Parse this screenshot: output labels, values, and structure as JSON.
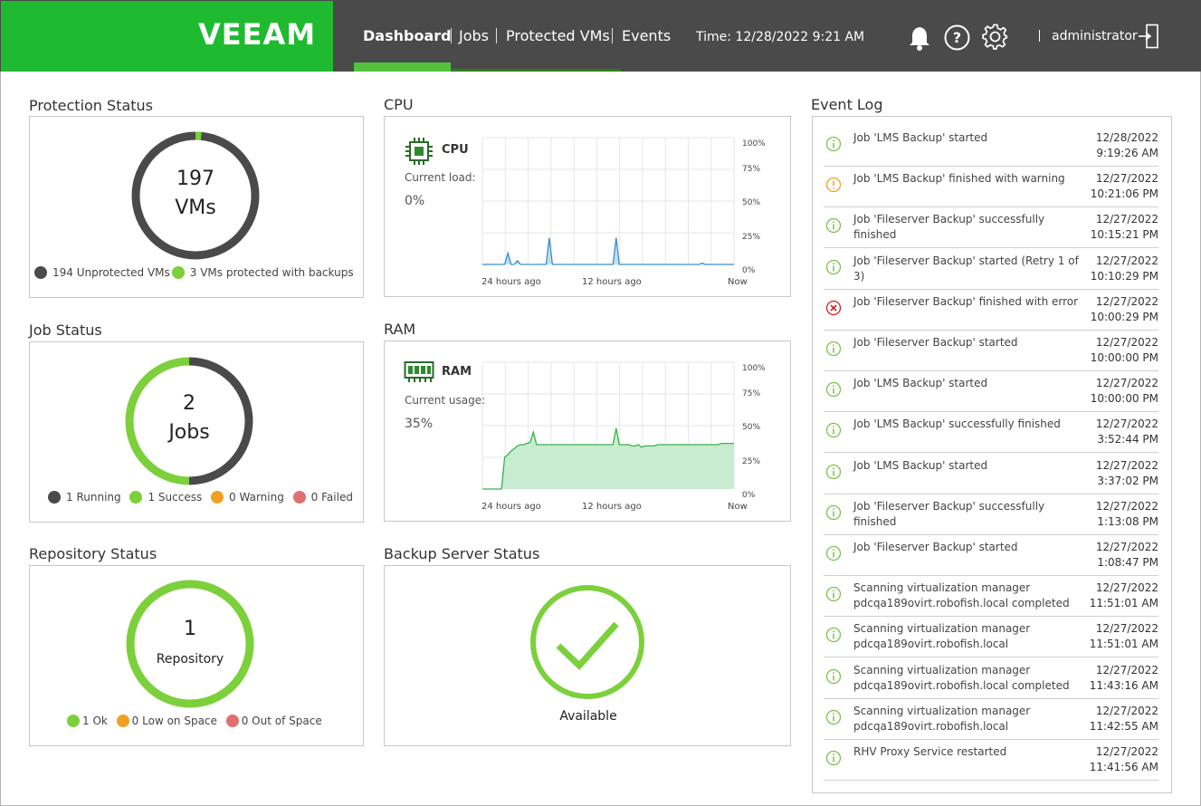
{
  "header": {
    "logo": "VEEAM",
    "nav": [
      "Dashboard",
      "Jobs",
      "Protected VMs",
      "Events"
    ],
    "time": "Time: 12/28/2022 9:21 AM",
    "user": "administrator",
    "icons": [
      "bell-icon",
      "help-icon",
      "settings-icon",
      "logout-icon"
    ]
  },
  "protection": {
    "title": "Protection Status",
    "count": "197",
    "unit": "VMs",
    "legend": [
      "194 Unprotected VMs",
      "3 VMs protected with backups"
    ],
    "protected_fraction": 0.0152,
    "colors": {
      "unprotected": "#4a4a4a",
      "protected": "#7cd03b"
    }
  },
  "cpu": {
    "section_title": "CPU",
    "name": "CPU",
    "load_label": "Current load:",
    "load_value": "0%",
    "y_ticks": [
      "100%",
      "75%",
      "50%",
      "25%",
      "0%"
    ],
    "x_ticks": [
      "24 hours ago",
      "12 hours ago",
      "Now"
    ],
    "values": [
      0,
      0,
      0,
      0,
      0,
      0,
      0,
      0,
      9,
      0,
      0,
      3,
      0,
      0,
      0,
      0,
      0,
      0,
      0,
      0,
      0,
      21,
      0,
      0,
      0,
      0,
      0,
      0,
      0,
      0,
      0,
      0,
      0,
      0,
      0,
      0,
      0,
      0,
      0,
      0,
      0,
      0,
      21,
      0,
      0,
      0,
      0,
      0,
      0,
      0,
      0,
      0,
      0,
      0,
      0,
      0,
      0,
      0,
      0,
      0,
      0,
      0,
      0,
      0,
      0,
      0,
      0,
      0,
      0,
      1,
      0,
      0,
      0,
      0,
      0,
      0,
      0,
      0,
      0,
      0
    ],
    "color": "#3a8fc9"
  },
  "ram": {
    "section_title": "RAM",
    "name": "RAM",
    "usage_label": "Current usage:",
    "usage_value": "35%",
    "y_ticks": [
      "100%",
      "75%",
      "50%",
      "25%",
      "0%"
    ],
    "x_ticks": [
      "24 hours ago",
      "12 hours ago",
      "Now"
    ],
    "values": [
      0,
      0,
      0,
      0,
      0,
      0,
      0,
      25,
      27,
      30,
      32,
      34,
      35,
      35,
      36,
      37,
      45,
      35,
      35,
      35,
      35,
      35,
      35,
      35,
      35,
      35,
      35,
      35,
      35,
      35,
      35,
      35,
      35,
      35,
      35,
      35,
      35,
      35,
      35,
      35,
      35,
      35,
      48,
      35,
      35,
      35,
      35,
      34,
      34,
      35,
      33,
      34,
      34,
      34,
      34,
      35,
      35,
      35,
      35,
      35,
      35,
      35,
      35,
      35,
      35,
      35,
      35,
      35,
      35,
      35,
      35,
      35,
      35,
      35,
      35,
      36,
      36,
      36,
      36,
      36
    ],
    "color": "#37b24d"
  },
  "jobs": {
    "title": "Job Status",
    "count": "2",
    "unit": "Jobs",
    "legend": [
      "1 Running",
      "1 Success",
      "0 Warning",
      "0 Failed"
    ],
    "colors": [
      "#4a4a4a",
      "#7cd03b",
      "#f0a020",
      "#e07070"
    ]
  },
  "repository": {
    "title": "Repository Status",
    "count": "1",
    "unit": "Repository",
    "legend": [
      "1 Ok",
      "0 Low on Space",
      "0 Out of Space"
    ],
    "colors": [
      "#7cd03b",
      "#f0a020",
      "#e07070"
    ]
  },
  "server": {
    "title": "Backup Server Status",
    "status": "Available"
  },
  "event_log": {
    "title": "Event Log",
    "events": [
      {
        "type": "info",
        "text": "Job 'LMS Backup' started",
        "date": "12/28/2022",
        "time": "9:19:26 AM"
      },
      {
        "type": "warning",
        "text": "Job 'LMS Backup' finished with warning",
        "date": "12/27/2022",
        "time": "10:21:06 PM"
      },
      {
        "type": "info",
        "text": "Job 'Fileserver Backup' successfully finished",
        "date": "12/27/2022",
        "time": "10:15:21 PM"
      },
      {
        "type": "info",
        "text": "Job 'Fileserver Backup' started (Retry 1 of 3)",
        "date": "12/27/2022",
        "time": "10:10:29 PM"
      },
      {
        "type": "error",
        "text": "Job 'Fileserver Backup' finished with error",
        "date": "12/27/2022",
        "time": "10:00:29 PM"
      },
      {
        "type": "info",
        "text": "Job 'Fileserver Backup' started",
        "date": "12/27/2022",
        "time": "10:00:00 PM"
      },
      {
        "type": "info",
        "text": "Job 'LMS Backup' started",
        "date": "12/27/2022",
        "time": "10:00:00 PM"
      },
      {
        "type": "info",
        "text": "Job 'LMS Backup' successfully finished",
        "date": "12/27/2022",
        "time": "3:52:44 PM"
      },
      {
        "type": "info",
        "text": "Job 'LMS Backup' started",
        "date": "12/27/2022",
        "time": "3:37:02 PM"
      },
      {
        "type": "info",
        "text": "Job 'Fileserver Backup' successfully finished",
        "date": "12/27/2022",
        "time": "1:13:08 PM"
      },
      {
        "type": "info",
        "text": "Job 'Fileserver Backup' started",
        "date": "12/27/2022",
        "time": "1:08:47 PM"
      },
      {
        "type": "info",
        "text": "Scanning virtualization manager pdcqa189ovirt.robofish.local completed",
        "date": "12/27/2022",
        "time": "11:51:01 AM"
      },
      {
        "type": "info",
        "text": "Scanning virtualization manager pdcqa189ovirt.robofish.local",
        "date": "12/27/2022",
        "time": "11:51:01 AM"
      },
      {
        "type": "info",
        "text": "Scanning virtualization manager pdcqa189ovirt.robofish.local completed",
        "date": "12/27/2022",
        "time": "11:43:16 AM"
      },
      {
        "type": "info",
        "text": "Scanning virtualization manager pdcqa189ovirt.robofish.local",
        "date": "12/27/2022",
        "time": "11:42:55 AM"
      },
      {
        "type": "info",
        "text": "RHV Proxy Service restarted",
        "date": "12/27/2022",
        "time": "11:41:56 AM"
      }
    ]
  }
}
